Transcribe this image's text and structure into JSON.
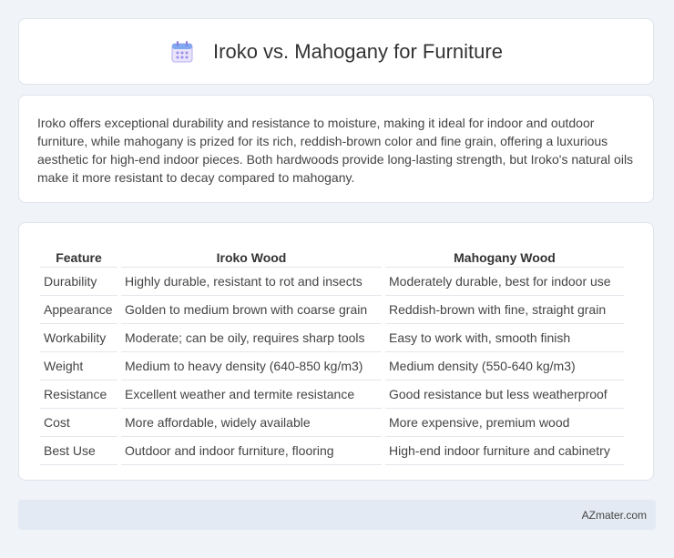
{
  "header": {
    "title": "Iroko vs. Mahogany for Furniture",
    "icon": "calendar-icon"
  },
  "description": {
    "text": "Iroko offers exceptional durability and resistance to moisture, making it ideal for indoor and outdoor furniture, while mahogany is prized for its rich, reddish-brown color and fine grain, offering a luxurious aesthetic for high-end indoor pieces. Both hardwoods provide long-lasting strength, but Iroko's natural oils make it more resistant to decay compared to mahogany."
  },
  "table": {
    "headers": [
      "Feature",
      "Iroko Wood",
      "Mahogany Wood"
    ],
    "rows": [
      [
        "Durability",
        "Highly durable, resistant to rot and insects",
        "Moderately durable, best for indoor use"
      ],
      [
        "Appearance",
        "Golden to medium brown with coarse grain",
        "Reddish-brown with fine, straight grain"
      ],
      [
        "Workability",
        "Moderate; can be oily, requires sharp tools",
        "Easy to work with, smooth finish"
      ],
      [
        "Weight",
        "Medium to heavy density (640-850 kg/m3)",
        "Medium density (550-640 kg/m3)"
      ],
      [
        "Resistance",
        "Excellent weather and termite resistance",
        "Good resistance but less weatherproof"
      ],
      [
        "Cost",
        "More affordable, widely available",
        "More expensive, premium wood"
      ],
      [
        "Best Use",
        "Outdoor and indoor furniture, flooring",
        "High-end indoor furniture and cabinetry"
      ]
    ]
  },
  "footer": {
    "brand": "AZmater.com"
  },
  "colors": {
    "background": "#f0f3f8",
    "card": "#ffffff",
    "footer": "#e4eaf3",
    "icon_accent": "#7b6fd6"
  }
}
